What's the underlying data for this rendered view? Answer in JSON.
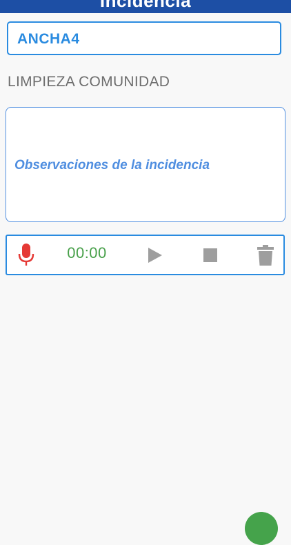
{
  "app_bar": {
    "title": "Incidencia",
    "color": "#1d4fa5"
  },
  "code_field": {
    "value": "ANCHA4"
  },
  "category": {
    "label": "LIMPIEZA COMUNIDAD"
  },
  "observations": {
    "placeholder": "Observaciones de la incidencia"
  },
  "recorder": {
    "timer": "00:00",
    "mic_icon": "mic-icon",
    "play_icon": "play-icon",
    "stop_icon": "stop-icon",
    "delete_icon": "trash-icon",
    "mic_color": "#e53935",
    "timer_color": "#48a04a",
    "controls_color": "#9e9e9e"
  },
  "fab": {
    "color": "#45a34b"
  }
}
